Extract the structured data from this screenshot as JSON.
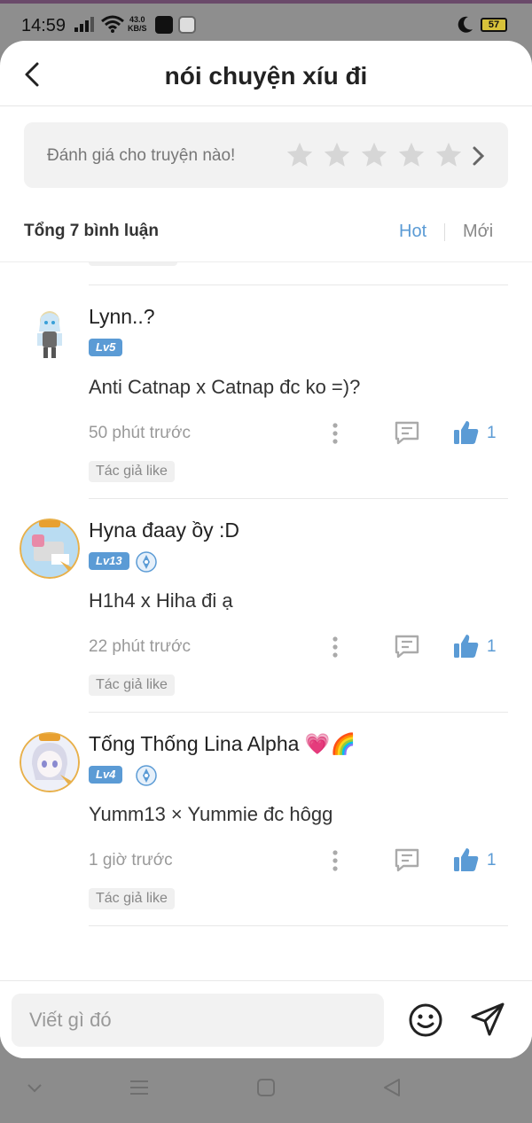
{
  "status_bar": {
    "time": "14:59",
    "net_speed_value": "43.0",
    "net_speed_unit": "KB/S",
    "battery": "57"
  },
  "header": {
    "title": "nói chuyện xíu đi"
  },
  "rating": {
    "label": "Đánh giá cho truyện nào!",
    "stars_total": 5,
    "stars_filled": 0
  },
  "comments_header": {
    "count_label": "Tổng 7 bình luận",
    "sort_hot": "Hot",
    "sort_new": "Mới",
    "active_sort": "Hot"
  },
  "comments": [
    {
      "name": "Lynn..?",
      "level": "Lv5",
      "writer_badge": false,
      "text": "Anti Catnap x Catnap đc ko =)?",
      "time": "50 phút trước",
      "likes": "1",
      "author_like": "Tác giả like"
    },
    {
      "name": "Hyna đaay ồy :D",
      "level": "Lv13",
      "writer_badge": true,
      "text": "H1h4 x Hiha đi ạ",
      "time": "22 phút trước",
      "likes": "1",
      "author_like": "Tác giả like"
    },
    {
      "name": "Tống Thống Lina Alpha 💗🌈",
      "level": "Lv4",
      "writer_badge": true,
      "text": "Yumm13 × Yummie đc hôgg",
      "time": "1 giờ trước",
      "likes": "1",
      "author_like": "Tác giả like"
    }
  ],
  "composer": {
    "placeholder": "Viết gì đó"
  },
  "colors": {
    "accent": "#5b9bd5",
    "muted_text": "#999999",
    "overlay": "#8c8c8c"
  },
  "icons": [
    "back-arrow-icon",
    "star-icon",
    "chevron-right-icon",
    "more-dots-icon",
    "reply-icon",
    "thumbs-up-icon",
    "emoji-icon",
    "send-icon",
    "writer-badge-icon"
  ]
}
